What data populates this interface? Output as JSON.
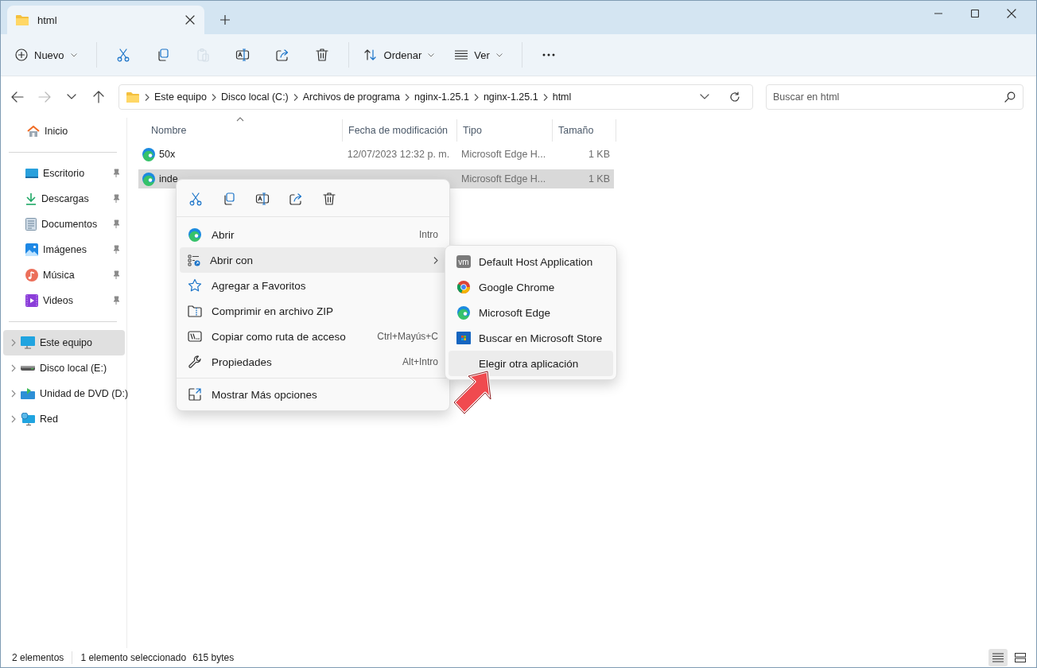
{
  "window": {
    "tab_title": "html"
  },
  "toolbar": [
    {
      "kind": "menu",
      "label": "Nuevo"
    },
    {
      "kind": "separator"
    },
    {
      "kind": "icon",
      "disabled": false
    },
    {
      "kind": "icon",
      "disabled": false
    },
    {
      "kind": "icon",
      "disabled": true
    },
    {
      "kind": "icon",
      "disabled": false
    },
    {
      "kind": "icon",
      "disabled": false
    },
    {
      "kind": "icon",
      "disabled": false
    },
    {
      "kind": "separator"
    },
    {
      "kind": "menu",
      "label": "Ordenar"
    },
    {
      "kind": "menu",
      "label": "Ver"
    },
    {
      "kind": "separator"
    },
    {
      "kind": "icon",
      "disabled": false
    }
  ],
  "navigation": [
    {
      "disabled": false
    },
    {
      "disabled": true
    },
    {
      "disabled": false
    },
    {
      "disabled": false
    }
  ],
  "address": {
    "crumbs": [
      "Este equipo",
      "Disco local (C:)",
      "Archivos de programa",
      "nginx-1.25.1",
      "nginx-1.25.1",
      "html"
    ]
  },
  "search": {
    "placeholder": "Buscar en html"
  },
  "sidebar": {
    "groups": [
      [
        {
          "label": "Inicio",
          "pinned": false,
          "expandable": false,
          "selected": false
        }
      ],
      [
        {
          "label": "Escritorio",
          "pinned": true,
          "expandable": false,
          "selected": false
        },
        {
          "label": "Descargas",
          "pinned": true,
          "expandable": false,
          "selected": false
        },
        {
          "label": "Documentos",
          "pinned": true,
          "expandable": false,
          "selected": false
        },
        {
          "label": "Imágenes",
          "pinned": true,
          "expandable": false,
          "selected": false
        },
        {
          "label": "Música",
          "pinned": true,
          "expandable": false,
          "selected": false
        },
        {
          "label": "Videos",
          "pinned": true,
          "expandable": false,
          "selected": false
        }
      ],
      [
        {
          "label": "Este equipo",
          "pinned": false,
          "expandable": true,
          "selected": true
        },
        {
          "label": "Disco local (E:)",
          "pinned": false,
          "expandable": true,
          "selected": false
        },
        {
          "label": "Unidad de DVD (D:)",
          "pinned": false,
          "expandable": true,
          "selected": false
        },
        {
          "label": "Red",
          "pinned": false,
          "expandable": true,
          "selected": false
        }
      ]
    ]
  },
  "table": {
    "columns": [
      {
        "label": "Nombre",
        "sorted": true
      },
      {
        "label": "Fecha de modificación",
        "sorted": false
      },
      {
        "label": "Tipo",
        "sorted": false
      },
      {
        "label": "Tamaño",
        "sorted": false
      }
    ],
    "rows": [
      {
        "name": "50x",
        "modified": "12/07/2023 12:32 p. m.",
        "type": "Microsoft Edge H...",
        "size": "1 KB",
        "selected": false
      },
      {
        "name": "inde",
        "type": "Microsoft Edge H...",
        "size": "1 KB",
        "selected": true
      }
    ]
  },
  "context_menu": {
    "items": [
      {
        "kind": "item",
        "label": "Abrir",
        "shortcut": "Intro",
        "hovered": false,
        "submenu": false
      },
      {
        "kind": "item",
        "label": "Abrir con",
        "hovered": true,
        "submenu": true
      },
      {
        "kind": "item",
        "label": "Agregar a Favoritos",
        "hovered": false,
        "submenu": false
      },
      {
        "kind": "item",
        "label": "Comprimir en archivo ZIP",
        "hovered": false,
        "submenu": false
      },
      {
        "kind": "item",
        "label": "Copiar como ruta de acceso",
        "shortcut": "Ctrl+Mayús+C",
        "hovered": false,
        "submenu": false
      },
      {
        "kind": "item",
        "label": "Propiedades",
        "shortcut": "Alt+Intro",
        "hovered": false,
        "submenu": false
      },
      {
        "kind": "separator"
      },
      {
        "kind": "item",
        "label": "Mostrar Más opciones",
        "hovered": false,
        "submenu": false
      }
    ]
  },
  "submenu": {
    "items": [
      {
        "label": "Default Host Application",
        "badge": "vm",
        "hovered": false
      },
      {
        "label": "Google Chrome",
        "hovered": false
      },
      {
        "label": "Microsoft Edge",
        "hovered": false
      },
      {
        "label": "Buscar en Microsoft Store",
        "hovered": false
      },
      {
        "label": "Elegir otra aplicación",
        "hovered": true
      }
    ]
  },
  "status_bar": {
    "count": "2 elementos",
    "selection": "1 elemento seleccionado",
    "size": "615 bytes"
  }
}
